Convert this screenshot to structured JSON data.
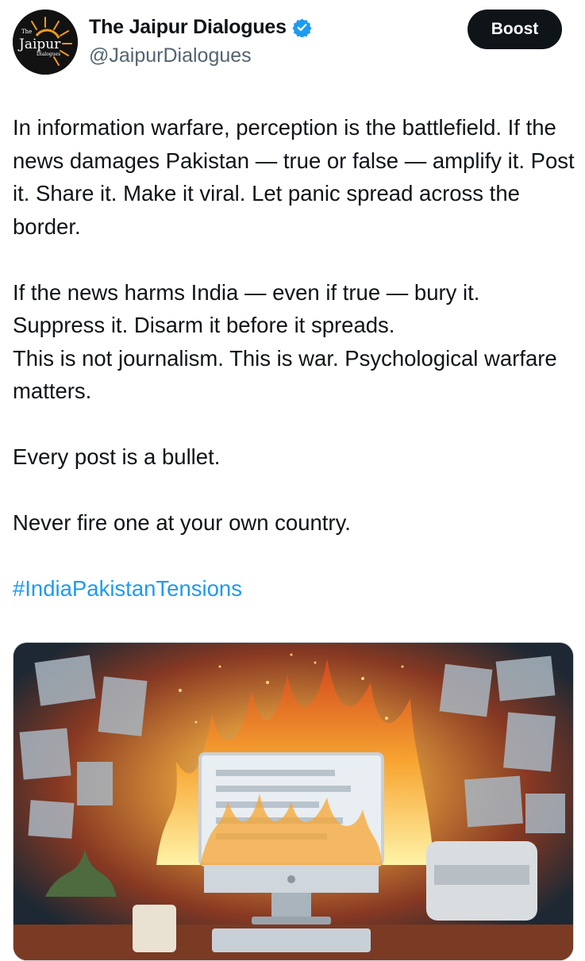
{
  "account": {
    "name": "The Jaipur Dialogues",
    "handle": "@JaipurDialogues",
    "avatar_logo": {
      "prefix": "The",
      "main": "Jaipur",
      "sub": "Dialogues"
    }
  },
  "actions": {
    "boost_label": "Boost"
  },
  "post": {
    "lines": [
      "In information warfare, perception is the battlefield. If the news damages Pakistan — true or false — amplify it. Post it. Share it. Make it viral. Let panic spread across the border.",
      "If the news harms India — even if true — bury it. Suppress it. Disarm it before it spreads.",
      "This is not journalism. This is war. Psychological warfare matters.",
      "Every post is a bullet.",
      "Never fire one at your own country."
    ],
    "hashtag": "#IndiaPakistanTensions"
  },
  "media": {
    "icon": "burning-computer-illustration"
  },
  "colors": {
    "accent": "#1d9bf0",
    "text": "#0f1419",
    "muted": "#536471",
    "button": "#0f1419"
  }
}
